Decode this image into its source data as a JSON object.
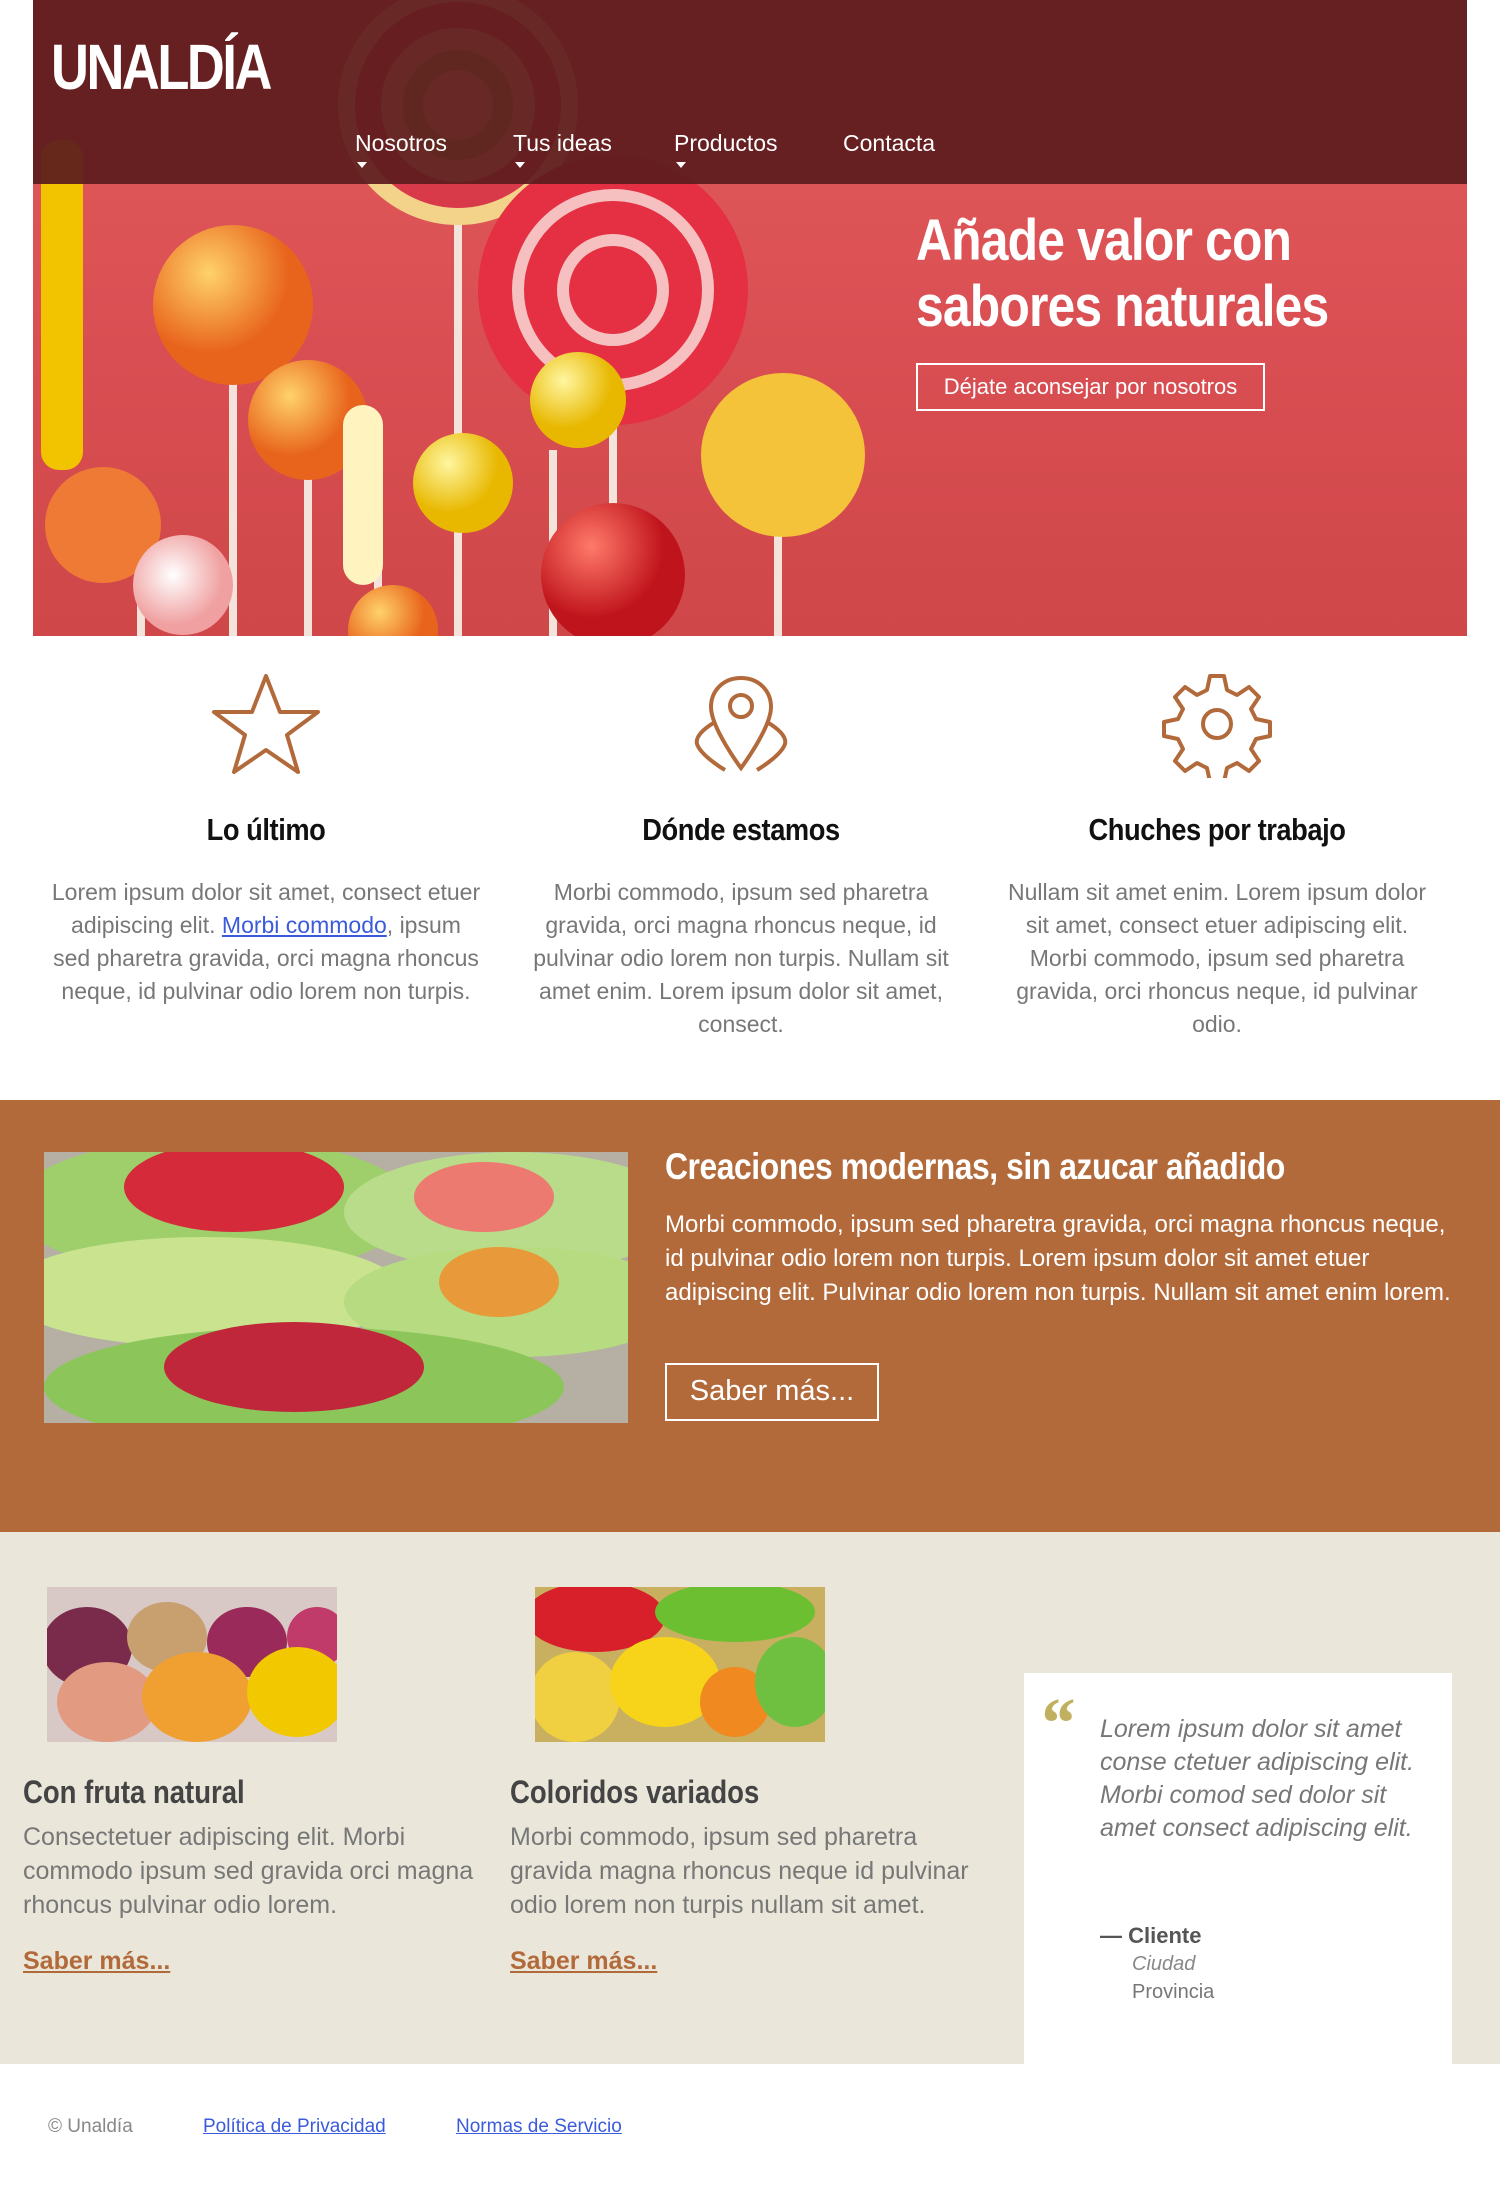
{
  "header": {
    "logo": "UNALDÍA",
    "nav": [
      {
        "label": "Nosotros",
        "has_dropdown": true
      },
      {
        "label": "Tus ideas",
        "has_dropdown": true
      },
      {
        "label": "Productos",
        "has_dropdown": true
      },
      {
        "label": "Contacta",
        "has_dropdown": false
      }
    ]
  },
  "hero": {
    "title_line1": "Añade valor con",
    "title_line2": "sabores naturales",
    "button": "Déjate aconsejar por nosotros"
  },
  "features": [
    {
      "icon": "star-icon",
      "title": "Lo último",
      "text_before": "Lorem ipsum dolor sit amet, consect etuer adipiscing elit. ",
      "link": "Morbi commodo",
      "text_after": ", ipsum sed pharetra gravida, orci magna rhoncus neque, id pulvinar odio lorem non turpis."
    },
    {
      "icon": "map-pin-icon",
      "title": "Dónde estamos",
      "text": "Morbi commodo, ipsum sed pharetra gravida, orci magna rhoncus neque, id pulvinar odio lorem non turpis. Nullam sit amet enim. Lorem ipsum dolor sit amet, consect."
    },
    {
      "icon": "gear-icon",
      "title": "Chuches por trabajo",
      "text": "Nullam sit amet enim. Lorem ipsum dolor sit amet, consect etuer adipiscing elit. Morbi commodo, ipsum sed pharetra gravida, orci rhoncus neque, id pulvinar odio."
    }
  ],
  "promo": {
    "title": "Creaciones modernas, sin azucar añadido",
    "text": "Morbi commodo, ipsum sed pharetra gravida, orci magna rhoncus neque, id pulvinar odio lorem non turpis. Lorem ipsum dolor sit amet etuer adipiscing elit. Pulvinar odio lorem non turpis. Nullam sit amet enim lorem.",
    "button": "Saber más..."
  },
  "cards": [
    {
      "title": "Con fruta natural",
      "text": "Consectetuer adipiscing elit. Morbi commodo ipsum sed gravida orci magna rhoncus pulvinar odio lorem.",
      "link": "Saber más..."
    },
    {
      "title": "Coloridos variados",
      "text": "Morbi commodo, ipsum sed pharetra gravida magna rhoncus neque id pulvinar odio lorem non turpis nullam sit amet.",
      "link": "Saber más..."
    }
  ],
  "testimonial": {
    "quote_mark": "“",
    "text": "Lorem ipsum dolor sit amet conse ctetuer adipiscing elit. Morbi comod sed dolor sit amet consect adipiscing elit.",
    "name": "— Cliente",
    "city": "Ciudad",
    "province": "Provincia"
  },
  "footer": {
    "copyright": "© Unaldía",
    "links": [
      "Política de Privacidad",
      "Normas de Servicio"
    ]
  },
  "colors": {
    "header_bg": "#5c1c1e",
    "hero_bg": "#d94e52",
    "accent_brown": "#b36a3b",
    "beige_bg": "#eae7da",
    "icon_color": "#b36a3b"
  }
}
